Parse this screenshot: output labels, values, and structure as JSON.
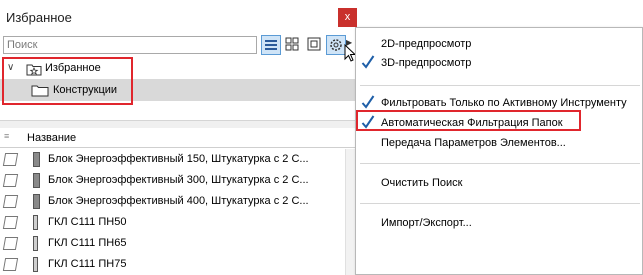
{
  "window": {
    "title": "Избранное",
    "close_label": "x"
  },
  "search": {
    "placeholder": "Поиск"
  },
  "tree": {
    "root_label": "Избранное",
    "child_label": "Конструкции"
  },
  "list": {
    "header": "Название",
    "rows": [
      {
        "label": "Блок Энергоэффективный 150, Штукатурка с 2 С...",
        "style": "thick"
      },
      {
        "label": "Блок Энергоэффективный 300, Штукатурка с 2 С...",
        "style": "thick"
      },
      {
        "label": "Блок Энергоэффективный 400, Штукатурка с 2 С...",
        "style": "thick"
      },
      {
        "label": "ГКЛ С111 ПН50",
        "style": "thin"
      },
      {
        "label": "ГКЛ С111 ПН65",
        "style": "thin"
      },
      {
        "label": "ГКЛ С111 ПН75",
        "style": "thin"
      }
    ]
  },
  "menu": {
    "items": [
      {
        "label": "2D-предпросмотр",
        "checked": false
      },
      {
        "label": "3D-предпросмотр",
        "checked": true
      },
      {
        "label": "Фильтровать Только по Активному Инструменту",
        "checked": true
      },
      {
        "label": "Автоматическая Фильтрация Папок",
        "checked": true
      },
      {
        "label": "Передача Параметров Элементов...",
        "checked": false
      },
      {
        "label": "Очистить Поиск",
        "checked": false
      },
      {
        "label": "Импорт/Экспорт...",
        "checked": false
      }
    ]
  },
  "colors": {
    "highlight_box": "#e0262d",
    "close_button": "#c9302c",
    "check_mark": "#1f5fa8",
    "selected_row": "#d9d9d9"
  }
}
